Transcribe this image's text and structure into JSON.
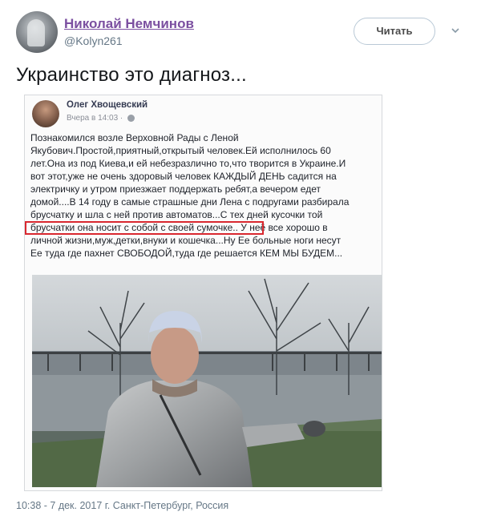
{
  "header": {
    "display_name": "Николай Немчинов",
    "handle": "@Kolyn261",
    "follow_label": "Читать"
  },
  "tweet": {
    "text": "Украинство это диагноз..."
  },
  "embedded_post": {
    "author": "Олег Хвощевский",
    "time": "Вчера в 14:03 ·",
    "lines": [
      "Познакомился возле Верховной Рады с Леной",
      "Якубович.Простой,приятный,открытый человек.Ей исполнилось 60",
      "лет.Она из под Киева,и ей небезразлично то,что творится в Украине.И",
      "вот этот,уже не очень здоровый человек КАЖДЫЙ ДЕНЬ садится на",
      "электричку и утром приезжает поддержать ребят,а вечером едет",
      "домой....В 14 году в самые страшные дни Лена с подругами разбирала",
      "брусчатку и шла с ней против автоматов...С тех дней кусочки той",
      "брусчатки она носит с собой с своей сумочке.. У неё все хорошо в",
      "личной жизни,муж,детки,внуки и кошечка...Ну Ее больные ноги несут",
      "Ее туда где пахнет СВОБОДОЙ,туда где решается КЕМ МЫ БУДЕМ..."
    ]
  },
  "caption": "10:38 - 7 дек. 2017 г. Санкт-Петербург, Россия",
  "colors": {
    "name": "#7b4fa0",
    "highlight": "#d9282f",
    "meta": "#657786"
  }
}
